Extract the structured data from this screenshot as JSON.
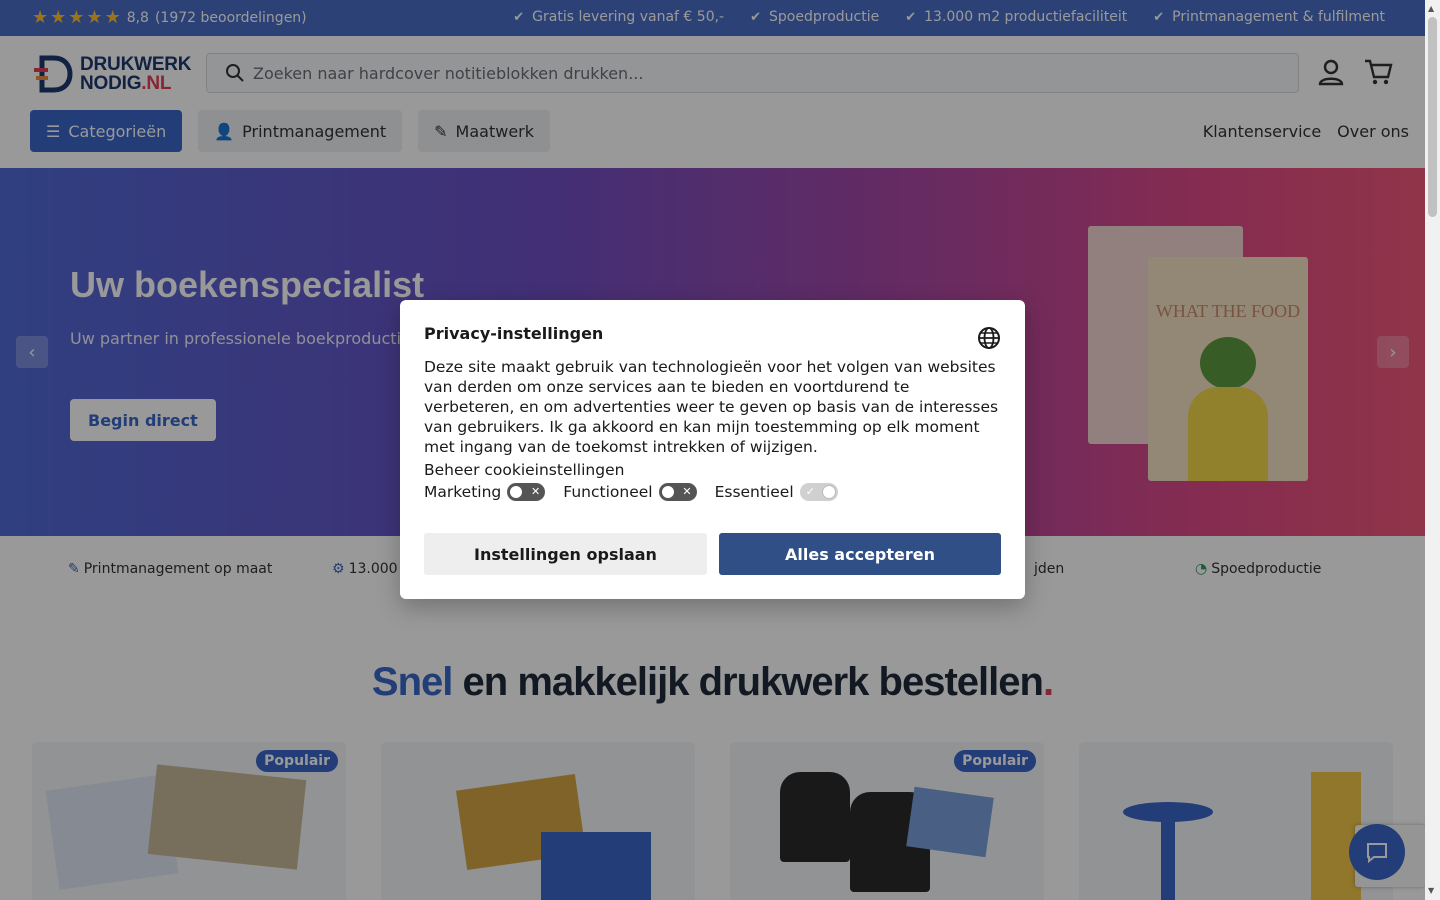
{
  "topbar": {
    "rating_score": "8,8",
    "rating_count": "(1972 beoordelingen)",
    "stars": 5,
    "usps": [
      "Gratis levering vanaf € 50,-",
      "Spoedproductie",
      "13.000 m2 productiefaciliteit",
      "Printmanagement & fulfilment"
    ]
  },
  "header": {
    "logo_line1": "DRUKWERK",
    "logo_line2": "NODIG",
    "logo_suffix": ".NL",
    "search_placeholder": "Zoeken naar hardcover notitieblokken drukken...",
    "nav": {
      "categories": "Categorieën",
      "printmanagement": "Printmanagement",
      "maatwerk": "Maatwerk"
    },
    "right_links": [
      "Klantenservice",
      "Over ons"
    ]
  },
  "hero": {
    "title": "Uw boekenspecialist",
    "subtitle": "Uw partner in professionele boekproducties",
    "cta": "Begin direct",
    "book_title": "WHAT THE FOOD"
  },
  "strip": {
    "items": [
      "Printmanagement op maat",
      "13.000",
      "jden",
      "Spoedproductie"
    ]
  },
  "main": {
    "heading_accent": "Snel",
    "heading_rest": " en makkelijk drukwerk bestellen",
    "heading_dot": ".",
    "badges": [
      "Populair",
      "Populair"
    ]
  },
  "modal": {
    "title": "Privacy-instellingen",
    "description": "Deze site maakt gebruik van technologieën voor het volgen van websites van derden om onze services aan te bieden en voortdurend te verbeteren, en om advertenties weer te geven op basis van de interesses van gebruikers. Ik ga akkoord en kan mijn toestemming op elk moment met ingang van de toekomst intrekken of wijzigen.",
    "manage": "Beheer cookieinstellingen",
    "toggles": [
      {
        "label": "Marketing",
        "on": false
      },
      {
        "label": "Functioneel",
        "on": false
      },
      {
        "label": "Essentieel",
        "on": true
      }
    ],
    "save_label": "Instellingen opslaan",
    "accept_label": "Alles accepteren"
  },
  "colors": {
    "brand_blue": "#3a66c7",
    "modal_primary": "#2f4f86",
    "accent_red": "#e23f58"
  }
}
